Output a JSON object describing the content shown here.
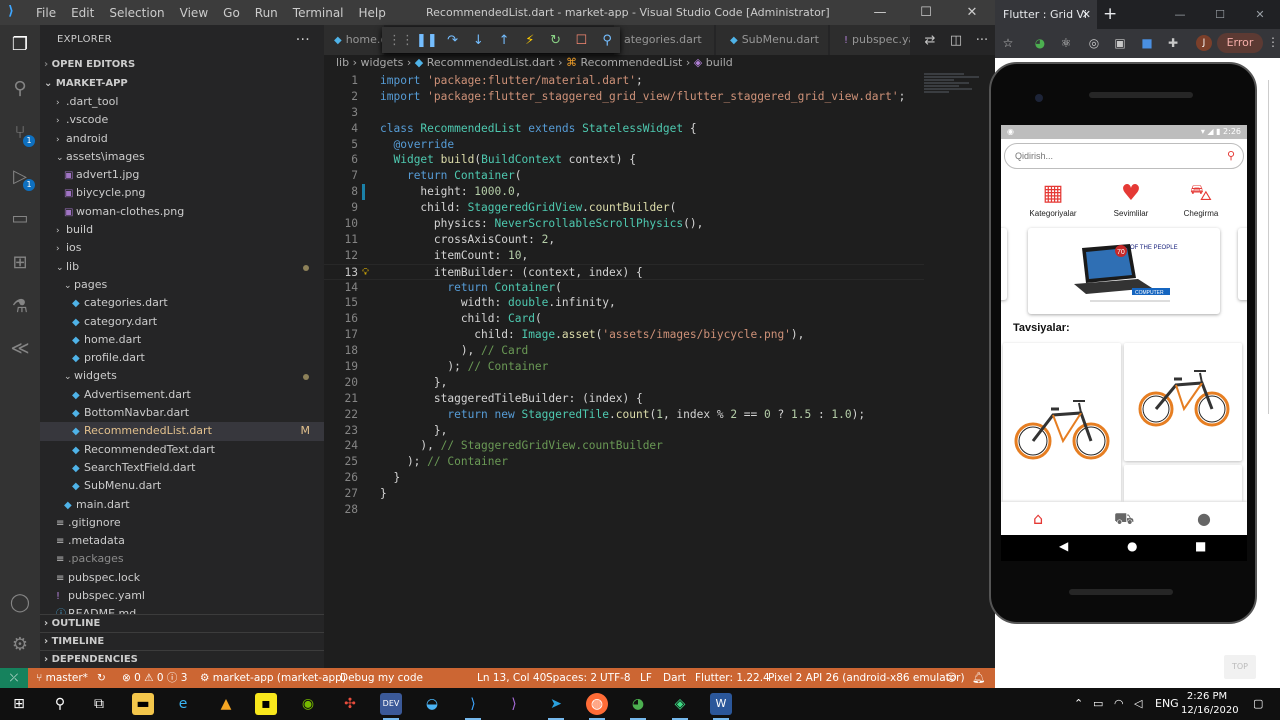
{
  "vscode": {
    "menu": [
      "File",
      "Edit",
      "Selection",
      "View",
      "Go",
      "Run",
      "Terminal",
      "Help"
    ],
    "title": "RecommendedList.dart - market-app - Visual Studio Code [Administrator]",
    "activity_badges": {
      "scm": "1",
      "debug": "1"
    },
    "sidebar": {
      "header": "EXPLORER",
      "open_editors": "OPEN EDITORS",
      "project": "MARKET-APP",
      "tree": [
        {
          "label": ".dart_tool",
          "type": "folder",
          "depth": 1
        },
        {
          "label": ".vscode",
          "type": "folder",
          "depth": 1
        },
        {
          "label": "android",
          "type": "folder",
          "depth": 1
        },
        {
          "label": "assets\\images",
          "type": "folder-open",
          "depth": 1
        },
        {
          "label": "advert1.jpg",
          "type": "image",
          "depth": 2
        },
        {
          "label": "biycycle.png",
          "type": "image",
          "depth": 2
        },
        {
          "label": "woman-clothes.png",
          "type": "image",
          "depth": 2
        },
        {
          "label": "build",
          "type": "folder",
          "depth": 1
        },
        {
          "label": "ios",
          "type": "folder",
          "depth": 1
        },
        {
          "label": "lib",
          "type": "folder-open",
          "depth": 1,
          "dot": true
        },
        {
          "label": "pages",
          "type": "folder-open",
          "depth": 2
        },
        {
          "label": "categories.dart",
          "type": "dart",
          "depth": 3
        },
        {
          "label": "category.dart",
          "type": "dart",
          "depth": 3
        },
        {
          "label": "home.dart",
          "type": "dart",
          "depth": 3
        },
        {
          "label": "profile.dart",
          "type": "dart",
          "depth": 3
        },
        {
          "label": "widgets",
          "type": "folder-open",
          "depth": 2,
          "dot": true
        },
        {
          "label": "Advertisement.dart",
          "type": "dart",
          "depth": 3
        },
        {
          "label": "BottomNavbar.dart",
          "type": "dart",
          "depth": 3
        },
        {
          "label": "RecommendedList.dart",
          "type": "dart",
          "depth": 3,
          "selected": true,
          "status": "M"
        },
        {
          "label": "RecommendedText.dart",
          "type": "dart",
          "depth": 3
        },
        {
          "label": "SearchTextField.dart",
          "type": "dart",
          "depth": 3
        },
        {
          "label": "SubMenu.dart",
          "type": "dart",
          "depth": 3
        },
        {
          "label": "main.dart",
          "type": "dart",
          "depth": 2
        },
        {
          "label": ".gitignore",
          "type": "file",
          "depth": 1
        },
        {
          "label": ".metadata",
          "type": "file",
          "depth": 1
        },
        {
          "label": ".packages",
          "type": "file-dim",
          "depth": 1
        },
        {
          "label": "pubspec.lock",
          "type": "file",
          "depth": 1
        },
        {
          "label": "pubspec.yaml",
          "type": "yaml",
          "depth": 1
        },
        {
          "label": "README.md",
          "type": "md",
          "depth": 1
        }
      ],
      "outline": "OUTLINE",
      "timeline": "TIMELINE",
      "dependencies": "DEPENDENCIES"
    },
    "tabs": [
      {
        "label": "home.d"
      },
      {
        "label": "ategories.dart"
      },
      {
        "label": "SubMenu.dart"
      },
      {
        "label": "pubspec.ya"
      }
    ],
    "breadcrumb": [
      "lib",
      "widgets",
      "RecommendedList.dart",
      "RecommendedList",
      "build"
    ],
    "code_lines": [
      [
        [
          "kw",
          "import "
        ],
        [
          "st",
          "'package:flutter/material.dart'"
        ],
        [
          "",
          "; "
        ]
      ],
      [
        [
          "kw",
          "import "
        ],
        [
          "st",
          "'package:flutter_staggered_grid_view/flutter_staggered_grid_view.dart'"
        ],
        [
          "",
          ";"
        ]
      ],
      [],
      [
        [
          "kw",
          "class "
        ],
        [
          "ty",
          "RecommendedList "
        ],
        [
          "kw",
          "extends "
        ],
        [
          "ty",
          "StatelessWidget"
        ],
        [
          "",
          " {"
        ]
      ],
      [
        [
          "",
          "  "
        ],
        [
          "an",
          "@override"
        ]
      ],
      [
        [
          "",
          "  "
        ],
        [
          "ty",
          "Widget "
        ],
        [
          "fn",
          "build"
        ],
        [
          "",
          "("
        ],
        [
          "ty",
          "BuildContext"
        ],
        [
          "",
          " context) {"
        ]
      ],
      [
        [
          "",
          "    "
        ],
        [
          "kw",
          "return "
        ],
        [
          "ty",
          "Container"
        ],
        [
          "",
          "("
        ]
      ],
      [
        [
          "",
          "      height: "
        ],
        [
          "nu",
          "1000.0"
        ],
        [
          "",
          ","
        ]
      ],
      [
        [
          "",
          "      child: "
        ],
        [
          "ty",
          "StaggeredGridView"
        ],
        [
          "",
          "."
        ],
        [
          "fn",
          "countBuilder"
        ],
        [
          "",
          "("
        ]
      ],
      [
        [
          "",
          "        physics: "
        ],
        [
          "ty",
          "NeverScrollableScrollPhysics"
        ],
        [
          "",
          "(),"
        ]
      ],
      [
        [
          "",
          "        crossAxisCount: "
        ],
        [
          "nu",
          "2"
        ],
        [
          "",
          ","
        ]
      ],
      [
        [
          "",
          "        itemCount: "
        ],
        [
          "nu",
          "10"
        ],
        [
          "",
          ","
        ]
      ],
      [
        [
          "",
          "        itemBuilder: (context, index) {"
        ]
      ],
      [
        [
          "",
          "          "
        ],
        [
          "kw",
          "return "
        ],
        [
          "ty",
          "Container"
        ],
        [
          "",
          "("
        ]
      ],
      [
        [
          "",
          "            width: "
        ],
        [
          "ty",
          "double"
        ],
        [
          "",
          ".infinity,"
        ]
      ],
      [
        [
          "",
          "            child: "
        ],
        [
          "ty",
          "Card"
        ],
        [
          "",
          "("
        ]
      ],
      [
        [
          "",
          "              child: "
        ],
        [
          "ty",
          "Image"
        ],
        [
          "",
          "."
        ],
        [
          "fn",
          "asset"
        ],
        [
          "",
          "("
        ],
        [
          "st",
          "'assets/images/biycycle.png'"
        ],
        [
          "",
          "),"
        ]
      ],
      [
        [
          "",
          "            ), "
        ],
        [
          "cm",
          "// Card"
        ]
      ],
      [
        [
          "",
          "          ); "
        ],
        [
          "cm",
          "// Container"
        ]
      ],
      [
        [
          "",
          "        },"
        ]
      ],
      [
        [
          "",
          "        staggeredTileBuilder: (index) {"
        ]
      ],
      [
        [
          "",
          "          "
        ],
        [
          "kw",
          "return new "
        ],
        [
          "ty",
          "StaggeredTile"
        ],
        [
          "",
          "."
        ],
        [
          "fn",
          "count"
        ],
        [
          "",
          "("
        ],
        [
          "nu",
          "1"
        ],
        [
          "",
          ", index % "
        ],
        [
          "nu",
          "2"
        ],
        [
          "",
          " == "
        ],
        [
          "nu",
          "0"
        ],
        [
          "",
          " ? "
        ],
        [
          "nu",
          "1.5"
        ],
        [
          "",
          " : "
        ],
        [
          "nu",
          "1.0"
        ],
        [
          "",
          ");"
        ]
      ],
      [
        [
          "",
          "        },"
        ]
      ],
      [
        [
          "",
          "      ), "
        ],
        [
          "cm",
          "// StaggeredGridView.countBuilder"
        ]
      ],
      [
        [
          "",
          "    ); "
        ],
        [
          "cm",
          "// Container"
        ]
      ],
      [
        [
          "",
          "  }"
        ]
      ],
      [
        [
          "",
          "}"
        ]
      ],
      []
    ],
    "status": {
      "branch": "master*",
      "problems": "⊗ 0 ⚠ 0 ⓘ 3",
      "project": "market-app (market-app)",
      "debug": "Debug my code",
      "position": "Ln 13, Col 40",
      "spaces": "Spaces: 2",
      "encoding": "UTF-8",
      "eol": "LF",
      "language": "Dart",
      "flutter": "Flutter: 1.22.4",
      "device": "Pixel 2 API 26 (android-x86 emulator)"
    }
  },
  "chrome": {
    "tab_title": "Flutter : Grid Vi",
    "profile_initial": "J",
    "error_label": "Error",
    "top_button": "TOP"
  },
  "app": {
    "time": "2:26",
    "search_placeholder": "Qidirish...",
    "categories": [
      {
        "label": "Kategoriyalar",
        "icon": "grid-icon"
      },
      {
        "label": "Sevimlilar",
        "icon": "heart-icon"
      },
      {
        "label": "Chegirma",
        "icon": "basket-icon"
      }
    ],
    "banner": {
      "headline_num": "70",
      "headline": "OF THE PEOPLE",
      "tag": "COMPUTER"
    },
    "recommended_title": "Tavsiyalar:"
  },
  "taskbar": {
    "lang": "ENG",
    "time": "2:26 PM",
    "date": "12/16/2020"
  },
  "colors": {
    "accent_red": "#e53935",
    "status_orange": "#cc6633",
    "remote_green": "#16825d"
  }
}
